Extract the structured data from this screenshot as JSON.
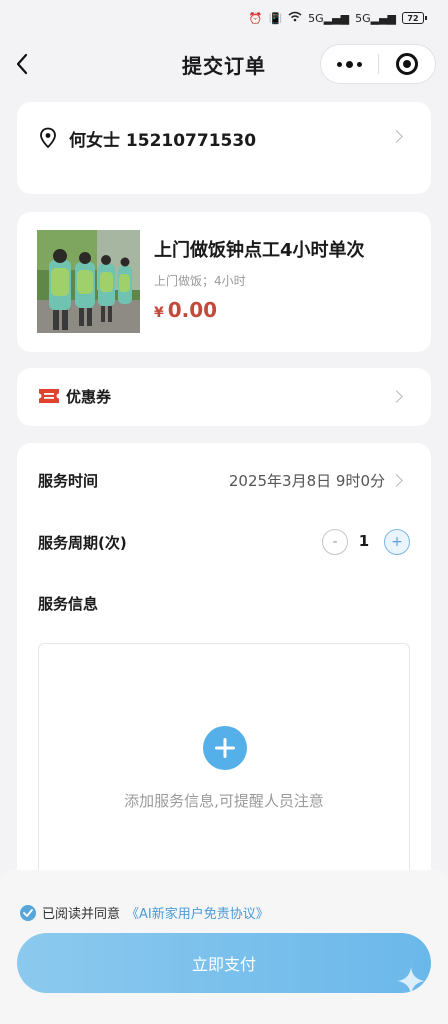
{
  "status_bar": {
    "signal_1": "5G",
    "signal_2": "5G",
    "battery": "72"
  },
  "nav": {
    "title": "提交订单"
  },
  "address": {
    "text": "何女士 15210771530"
  },
  "product": {
    "name": "上门做饭钟点工4小时单次",
    "subtitle": "上门做饭；4小时",
    "currency": "¥",
    "price": "0.00"
  },
  "coupon": {
    "label": "优惠券"
  },
  "service": {
    "time_label": "服务时间",
    "time_value": "2025年3月8日 9时0分",
    "cycle_label": "服务周期(次)",
    "minus": "-",
    "cycle_value": "1",
    "plus": "+",
    "info_label": "服务信息",
    "info_hint": "添加服务信息,可提醒人员注意"
  },
  "footer": {
    "agree_text": "已阅读并同意",
    "agree_link": "《AI新家用户免责协议》",
    "pay_label": "立即支付"
  },
  "colors": {
    "accent": "#55b0ea",
    "price": "#c24a3c",
    "background": "#f3f3f5"
  },
  "icons": {
    "back": "back-arrow-icon",
    "more": "more-dots-icon",
    "target": "target-icon",
    "location": "location-pin-icon",
    "coupon": "ticket-icon",
    "add": "plus-icon",
    "check": "check-icon"
  }
}
